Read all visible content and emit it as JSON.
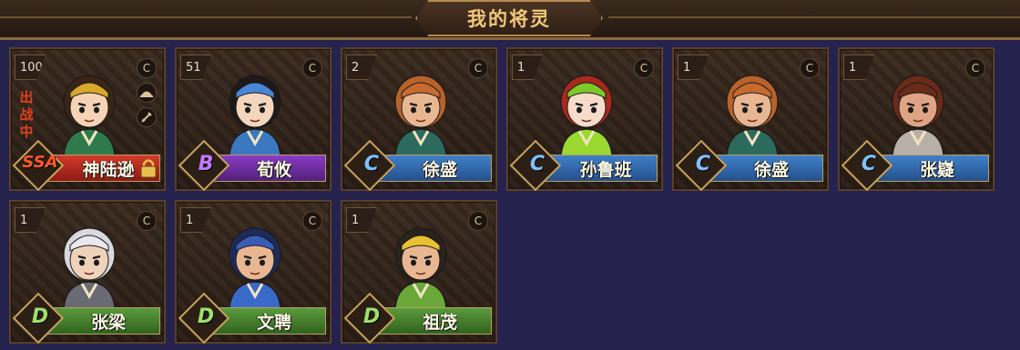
{
  "header": {
    "title": "我的将灵"
  },
  "cards": [
    {
      "level": "100",
      "name": "神陆逊",
      "rank": "SSA",
      "rank_class": "ssa",
      "status": "出战中",
      "locked": true,
      "extra_icons": true,
      "hair": "#3a2416",
      "skin": "#f5d3b4",
      "robe": "#2f7a4a",
      "hat": "#d8a82a"
    },
    {
      "level": "51",
      "name": "荀攸",
      "rank": "B",
      "rank_class": "b",
      "status": "",
      "locked": false,
      "extra_icons": false,
      "hair": "#1e1a18",
      "skin": "#f3d6bd",
      "robe": "#3b78c0",
      "hat": "#4a86d8"
    },
    {
      "level": "2",
      "name": "徐盛",
      "rank": "C",
      "rank_class": "c",
      "status": "",
      "locked": false,
      "extra_icons": false,
      "hair": "#b8622a",
      "skin": "#e8b792",
      "robe": "#2b6a5c",
      "hat": "#c86a30"
    },
    {
      "level": "1",
      "name": "孙鲁班",
      "rank": "C",
      "rank_class": "c",
      "status": "",
      "locked": false,
      "extra_icons": false,
      "hair": "#a8281c",
      "skin": "#f7dccb",
      "robe": "#9bd830",
      "hat": "#7fc82a"
    },
    {
      "level": "1",
      "name": "徐盛",
      "rank": "C",
      "rank_class": "c",
      "status": "",
      "locked": false,
      "extra_icons": false,
      "hair": "#b8622a",
      "skin": "#e8b792",
      "robe": "#2b6a5c",
      "hat": "#c86a30"
    },
    {
      "level": "1",
      "name": "张嶷",
      "rank": "C",
      "rank_class": "c",
      "status": "",
      "locked": false,
      "extra_icons": false,
      "hair": "#6a2a18",
      "skin": "#dea483",
      "robe": "#b8b0a8",
      "hat": "#6a2a18"
    },
    {
      "level": "1",
      "name": "张梁",
      "rank": "D",
      "rank_class": "d",
      "status": "",
      "locked": false,
      "extra_icons": false,
      "hair": "#d8d8de",
      "skin": "#f0d2ba",
      "robe": "#6a6a74",
      "hat": "#e8e8ee"
    },
    {
      "level": "1",
      "name": "文聘",
      "rank": "D",
      "rank_class": "d",
      "status": "",
      "locked": false,
      "extra_icons": false,
      "hair": "#1e2a5c",
      "skin": "#e8b792",
      "robe": "#3a6ac8",
      "hat": "#3a5cb8"
    },
    {
      "level": "1",
      "name": "祖茂",
      "rank": "D",
      "rank_class": "d",
      "status": "",
      "locked": false,
      "extra_icons": false,
      "hair": "#2a221c",
      "skin": "#e8b792",
      "robe": "#6aa83a",
      "hat": "#e8c030"
    }
  ],
  "icons": {
    "currency": "C",
    "hat": "hat-icon",
    "sword": "sword-icon"
  }
}
